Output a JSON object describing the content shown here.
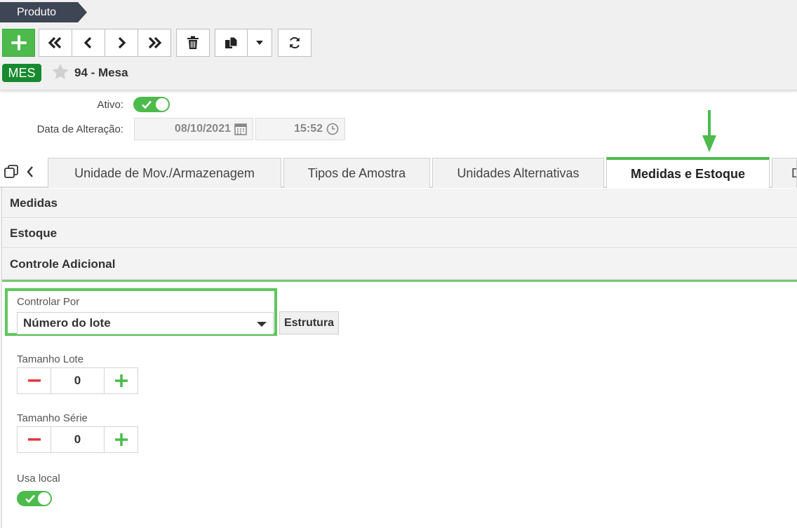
{
  "breadcrumb": {
    "label": "Produto"
  },
  "toolbar": {
    "buttons": [
      "add-icon",
      "first-icon",
      "prev-icon",
      "next-icon",
      "last-icon",
      "delete-icon",
      "copy-icon",
      "caret-down-icon",
      "refresh-icon"
    ]
  },
  "record": {
    "badge": "MES",
    "title": "94 - Mesa"
  },
  "form": {
    "ativo_label": "Ativo:",
    "data_alteracao_label": "Data de Alteração:",
    "date_value": "08/10/2021",
    "time_value": "15:52"
  },
  "tabs": [
    {
      "label": "Unidade de Mov./Armazenagem",
      "active": false
    },
    {
      "label": "Tipos de Amostra",
      "active": false
    },
    {
      "label": "Unidades Alternativas",
      "active": false
    },
    {
      "label": "Medidas e Estoque",
      "active": true
    },
    {
      "label": "D",
      "active": false
    }
  ],
  "sections": [
    "Medidas",
    "Estoque",
    "Controle Adicional"
  ],
  "controle": {
    "controlar_por_label": "Controlar Por",
    "controlar_por_value": "Número do lote",
    "estrutura_button": "Estrutura",
    "tamanho_lote_label": "Tamanho Lote",
    "tamanho_lote_value": "0",
    "tamanho_serie_label": "Tamanho Série",
    "tamanho_serie_value": "0",
    "usa_local_label": "Usa local"
  },
  "colors": {
    "accent_green": "#4cbb4c",
    "badge_green": "#178a2f",
    "breadcrumb_bg": "#3b4252",
    "minus_red": "#e0383e"
  }
}
